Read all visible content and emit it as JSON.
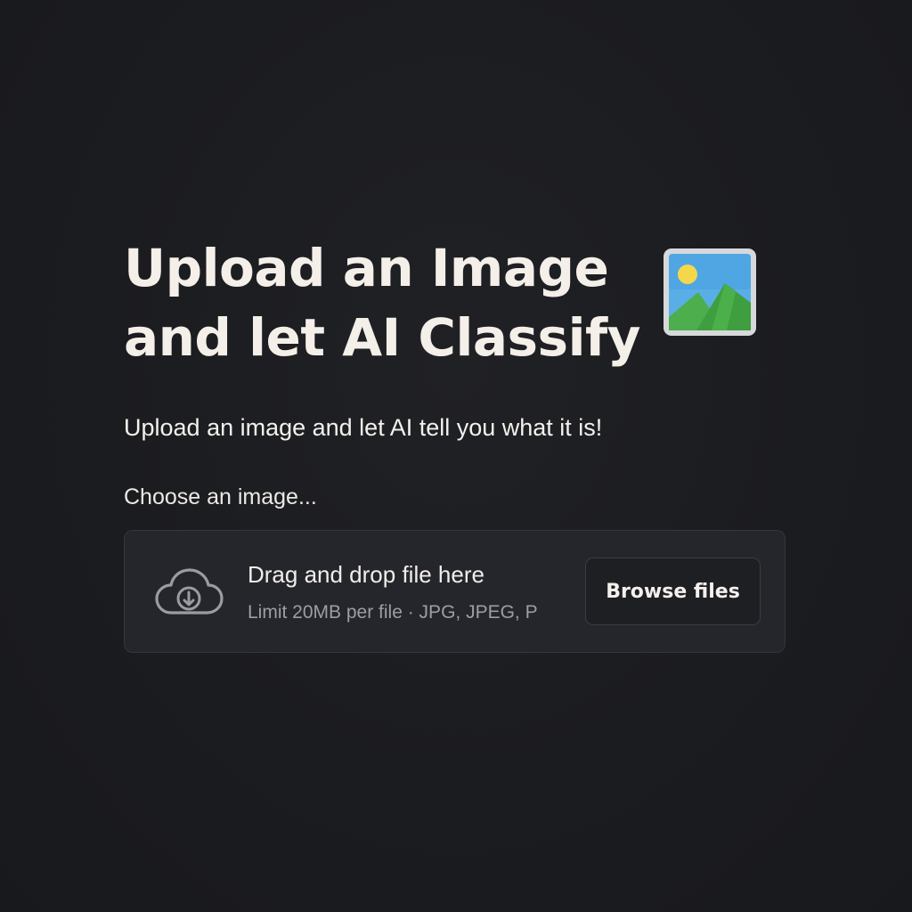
{
  "header": {
    "title_line1": "Upload an Image",
    "title_line2": "and let AI Classify",
    "title_icon": "framed-picture-icon"
  },
  "subtitle": "Upload an image and let AI tell you what it is!",
  "uploader": {
    "label": "Choose an image...",
    "dropzone_title": "Drag and drop file here",
    "dropzone_limit": "Limit 20MB per file · JPG, JPEG, P",
    "dropzone_icon": "cloud-download-icon",
    "browse_label": "Browse files"
  },
  "colors": {
    "background": "#1b1c20",
    "dropzone": "#25262b",
    "text": "#f4efe8",
    "muted_text": "#9c9ea4"
  }
}
